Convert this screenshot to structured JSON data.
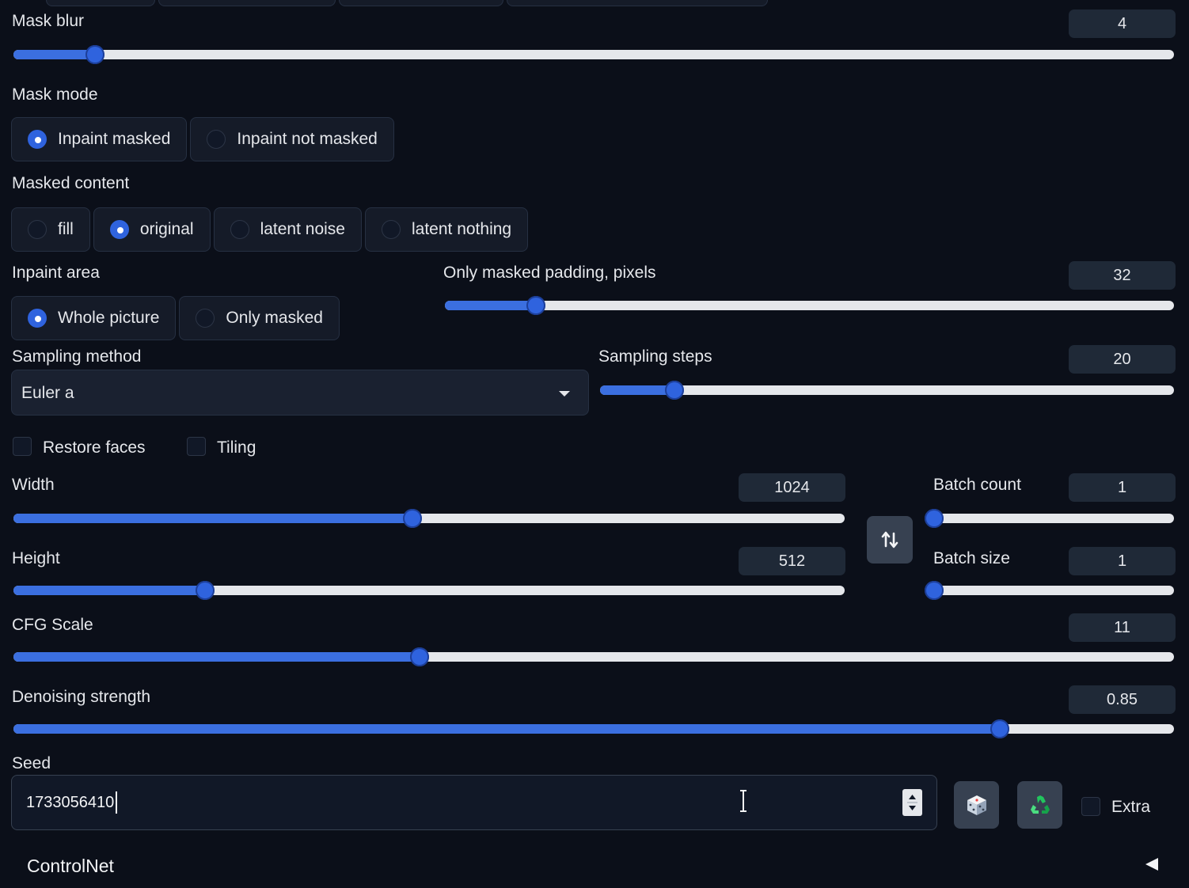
{
  "mask_blur": {
    "label": "Mask blur",
    "value": "4",
    "level": 0.07
  },
  "mask_mode": {
    "label": "Mask mode",
    "options": [
      {
        "label": "Inpaint masked",
        "selected": true
      },
      {
        "label": "Inpaint not masked",
        "selected": false
      }
    ]
  },
  "masked_content": {
    "label": "Masked content",
    "options": [
      {
        "label": "fill",
        "selected": false
      },
      {
        "label": "original",
        "selected": true
      },
      {
        "label": "latent noise",
        "selected": false
      },
      {
        "label": "latent nothing",
        "selected": false
      }
    ]
  },
  "inpaint_area": {
    "label": "Inpaint area",
    "options": [
      {
        "label": "Whole picture",
        "selected": true
      },
      {
        "label": "Only masked",
        "selected": false
      }
    ]
  },
  "only_masked_padding": {
    "label": "Only masked padding, pixels",
    "value": "32",
    "level": 0.125
  },
  "sampling_method": {
    "label": "Sampling method",
    "value": "Euler a"
  },
  "sampling_steps": {
    "label": "Sampling steps",
    "value": "20",
    "level": 0.13
  },
  "restore_faces": {
    "label": "Restore faces",
    "checked": false
  },
  "tiling": {
    "label": "Tiling",
    "checked": false
  },
  "width": {
    "label": "Width",
    "value": "1024",
    "level": 0.48
  },
  "height": {
    "label": "Height",
    "value": "512",
    "level": 0.23
  },
  "batch_count": {
    "label": "Batch count",
    "value": "1",
    "level": 0.0
  },
  "batch_size": {
    "label": "Batch size",
    "value": "1",
    "level": 0.0
  },
  "cfg_scale": {
    "label": "CFG Scale",
    "value": "11",
    "level": 0.35
  },
  "denoising_strength": {
    "label": "Denoising strength",
    "value": "0.85",
    "level": 0.85
  },
  "seed": {
    "label": "Seed",
    "value": "1733056410"
  },
  "extra": {
    "label": "Extra",
    "checked": false
  },
  "controlnet": {
    "label": "ControlNet"
  },
  "colors": {
    "accent": "#2f63de",
    "background": "#0b0f19",
    "panel": "#1f2937"
  },
  "icons": {
    "swap": "swap-dimensions-icon",
    "dice": "dice-icon",
    "recycle": "recycle-icon",
    "collapse": "triangle-left-icon",
    "dropdown": "chevron-down-icon"
  }
}
